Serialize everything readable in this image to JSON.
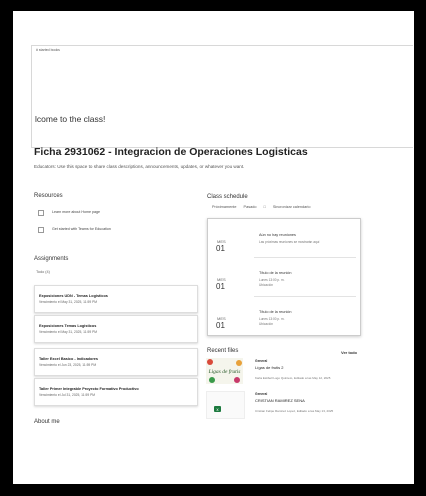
{
  "breadcrumb": "# started books",
  "welcome": "lcome to the class!",
  "class_title": "Ficha 2931062 - Integracion de Operaciones Logisticas",
  "class_subtitle": "Educators: Use this space to share class descriptions, announcements, updates, or whatever you want.",
  "resources": {
    "heading": "Resources",
    "items": [
      {
        "label": "Learn more about Home page"
      },
      {
        "label": "Get started with Teams for Education"
      }
    ]
  },
  "assignments": {
    "heading": "Assignments",
    "filter_label": "Todo (4)",
    "items": [
      {
        "title": "Exposiciones UDN - Temas Logisticos",
        "due": "Vencimiento el May 31, 2025, 11:59 PM"
      },
      {
        "title": "Exposiciones Temas Logisticos",
        "due": "Vencimiento el May 31, 2025, 11:59 PM"
      },
      {
        "title": "Taller Excel Basico - Indicadores",
        "due": "Vencimiento el Jun 23, 2025, 11:59 PM"
      },
      {
        "title": "Taller Primer Integrable Proyecto Formativo Productivo",
        "due": "Vencimiento el Jul 31, 2025, 11:59 PM"
      }
    ]
  },
  "about": {
    "heading": "About me"
  },
  "schedule": {
    "heading": "Class schedule",
    "tabs": [
      "Próximamente",
      "Pasado",
      "Sincronizar calendario"
    ],
    "events": [
      {
        "month": "MES",
        "day": "01",
        "title": "Aún no hay reuniones",
        "sub": "Las próximas reuniones se mostrarán aquí",
        "loc": ""
      },
      {
        "month": "MES",
        "day": "01",
        "title": "Título de la reunión",
        "sub": "Lunes 13:00 p. m.",
        "loc": "Ubicación"
      },
      {
        "month": "MES",
        "day": "01",
        "title": "Título de la reunión",
        "sub": "Lunes 13:00 p. m.",
        "loc": "Ubicación"
      }
    ]
  },
  "files": {
    "heading": "Recent files",
    "view_all": "Ver todo",
    "items": [
      {
        "channel": "General",
        "name": "Lígas de frutis 2",
        "meta": "Karla Estibell Lugo Quintero, Editado a las May 12, 2025",
        "thumb_text": "Ligas de frutis"
      },
      {
        "channel": "General",
        "name": "CRISTIAN RAMIREZ SENA",
        "meta": "Cristian Felipe Ramirez Lopez, Editado a las May 13, 2025",
        "thumb_text": ""
      }
    ]
  }
}
